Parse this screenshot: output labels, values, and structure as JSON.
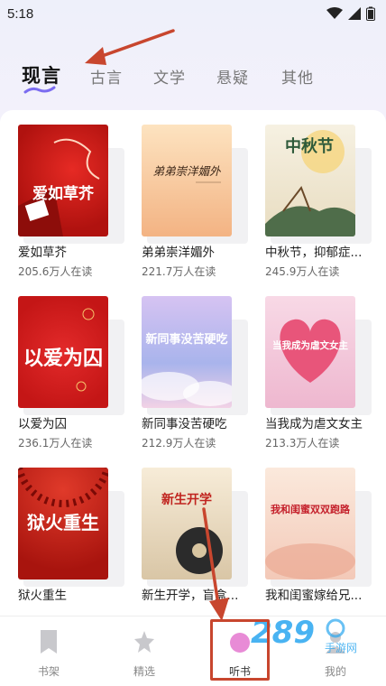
{
  "status": {
    "time": "5:18"
  },
  "tabs": [
    {
      "label": "现言",
      "active": true
    },
    {
      "label": "古言"
    },
    {
      "label": "文学"
    },
    {
      "label": "悬疑"
    },
    {
      "label": "其他"
    }
  ],
  "books": [
    {
      "title": "爱如草芥",
      "reads": "205.6万人在读",
      "cover_text": "爱如草芥"
    },
    {
      "title": "弟弟崇洋媚外",
      "reads": "221.7万人在读",
      "cover_text": "弟弟崇洋媚外"
    },
    {
      "title": "中秋节，抑郁症...",
      "reads": "245.9万人在读",
      "cover_text": "中秋节"
    },
    {
      "title": "以爱为囚",
      "reads": "236.1万人在读",
      "cover_text": "以爱为囚"
    },
    {
      "title": "新同事没苦硬吃",
      "reads": "212.9万人在读",
      "cover_text": "新同事没苦硬吃"
    },
    {
      "title": "当我成为虐文女主",
      "reads": "213.3万人在读",
      "cover_text": "当我成为虐文女主"
    },
    {
      "title": "狱火重生",
      "reads": "",
      "cover_text": "狱火重生"
    },
    {
      "title": "新生开学，盲盒...",
      "reads": "",
      "cover_text": "新生开学"
    },
    {
      "title": "我和闺蜜嫁给兄...",
      "reads": "",
      "cover_text": "我和闺蜜双双跑路"
    }
  ],
  "nav": [
    {
      "label": "书架",
      "icon": "bookmark-icon"
    },
    {
      "label": "精选",
      "icon": "star-icon"
    },
    {
      "label": "听书",
      "icon": "headphone-icon",
      "active": true
    },
    {
      "label": "我的",
      "icon": "user-icon"
    }
  ],
  "watermark": {
    "text": "289",
    "suffix": "手游网"
  },
  "colors": {
    "accent": "#c8462e",
    "tab_indicator": "#7b6cf0"
  }
}
